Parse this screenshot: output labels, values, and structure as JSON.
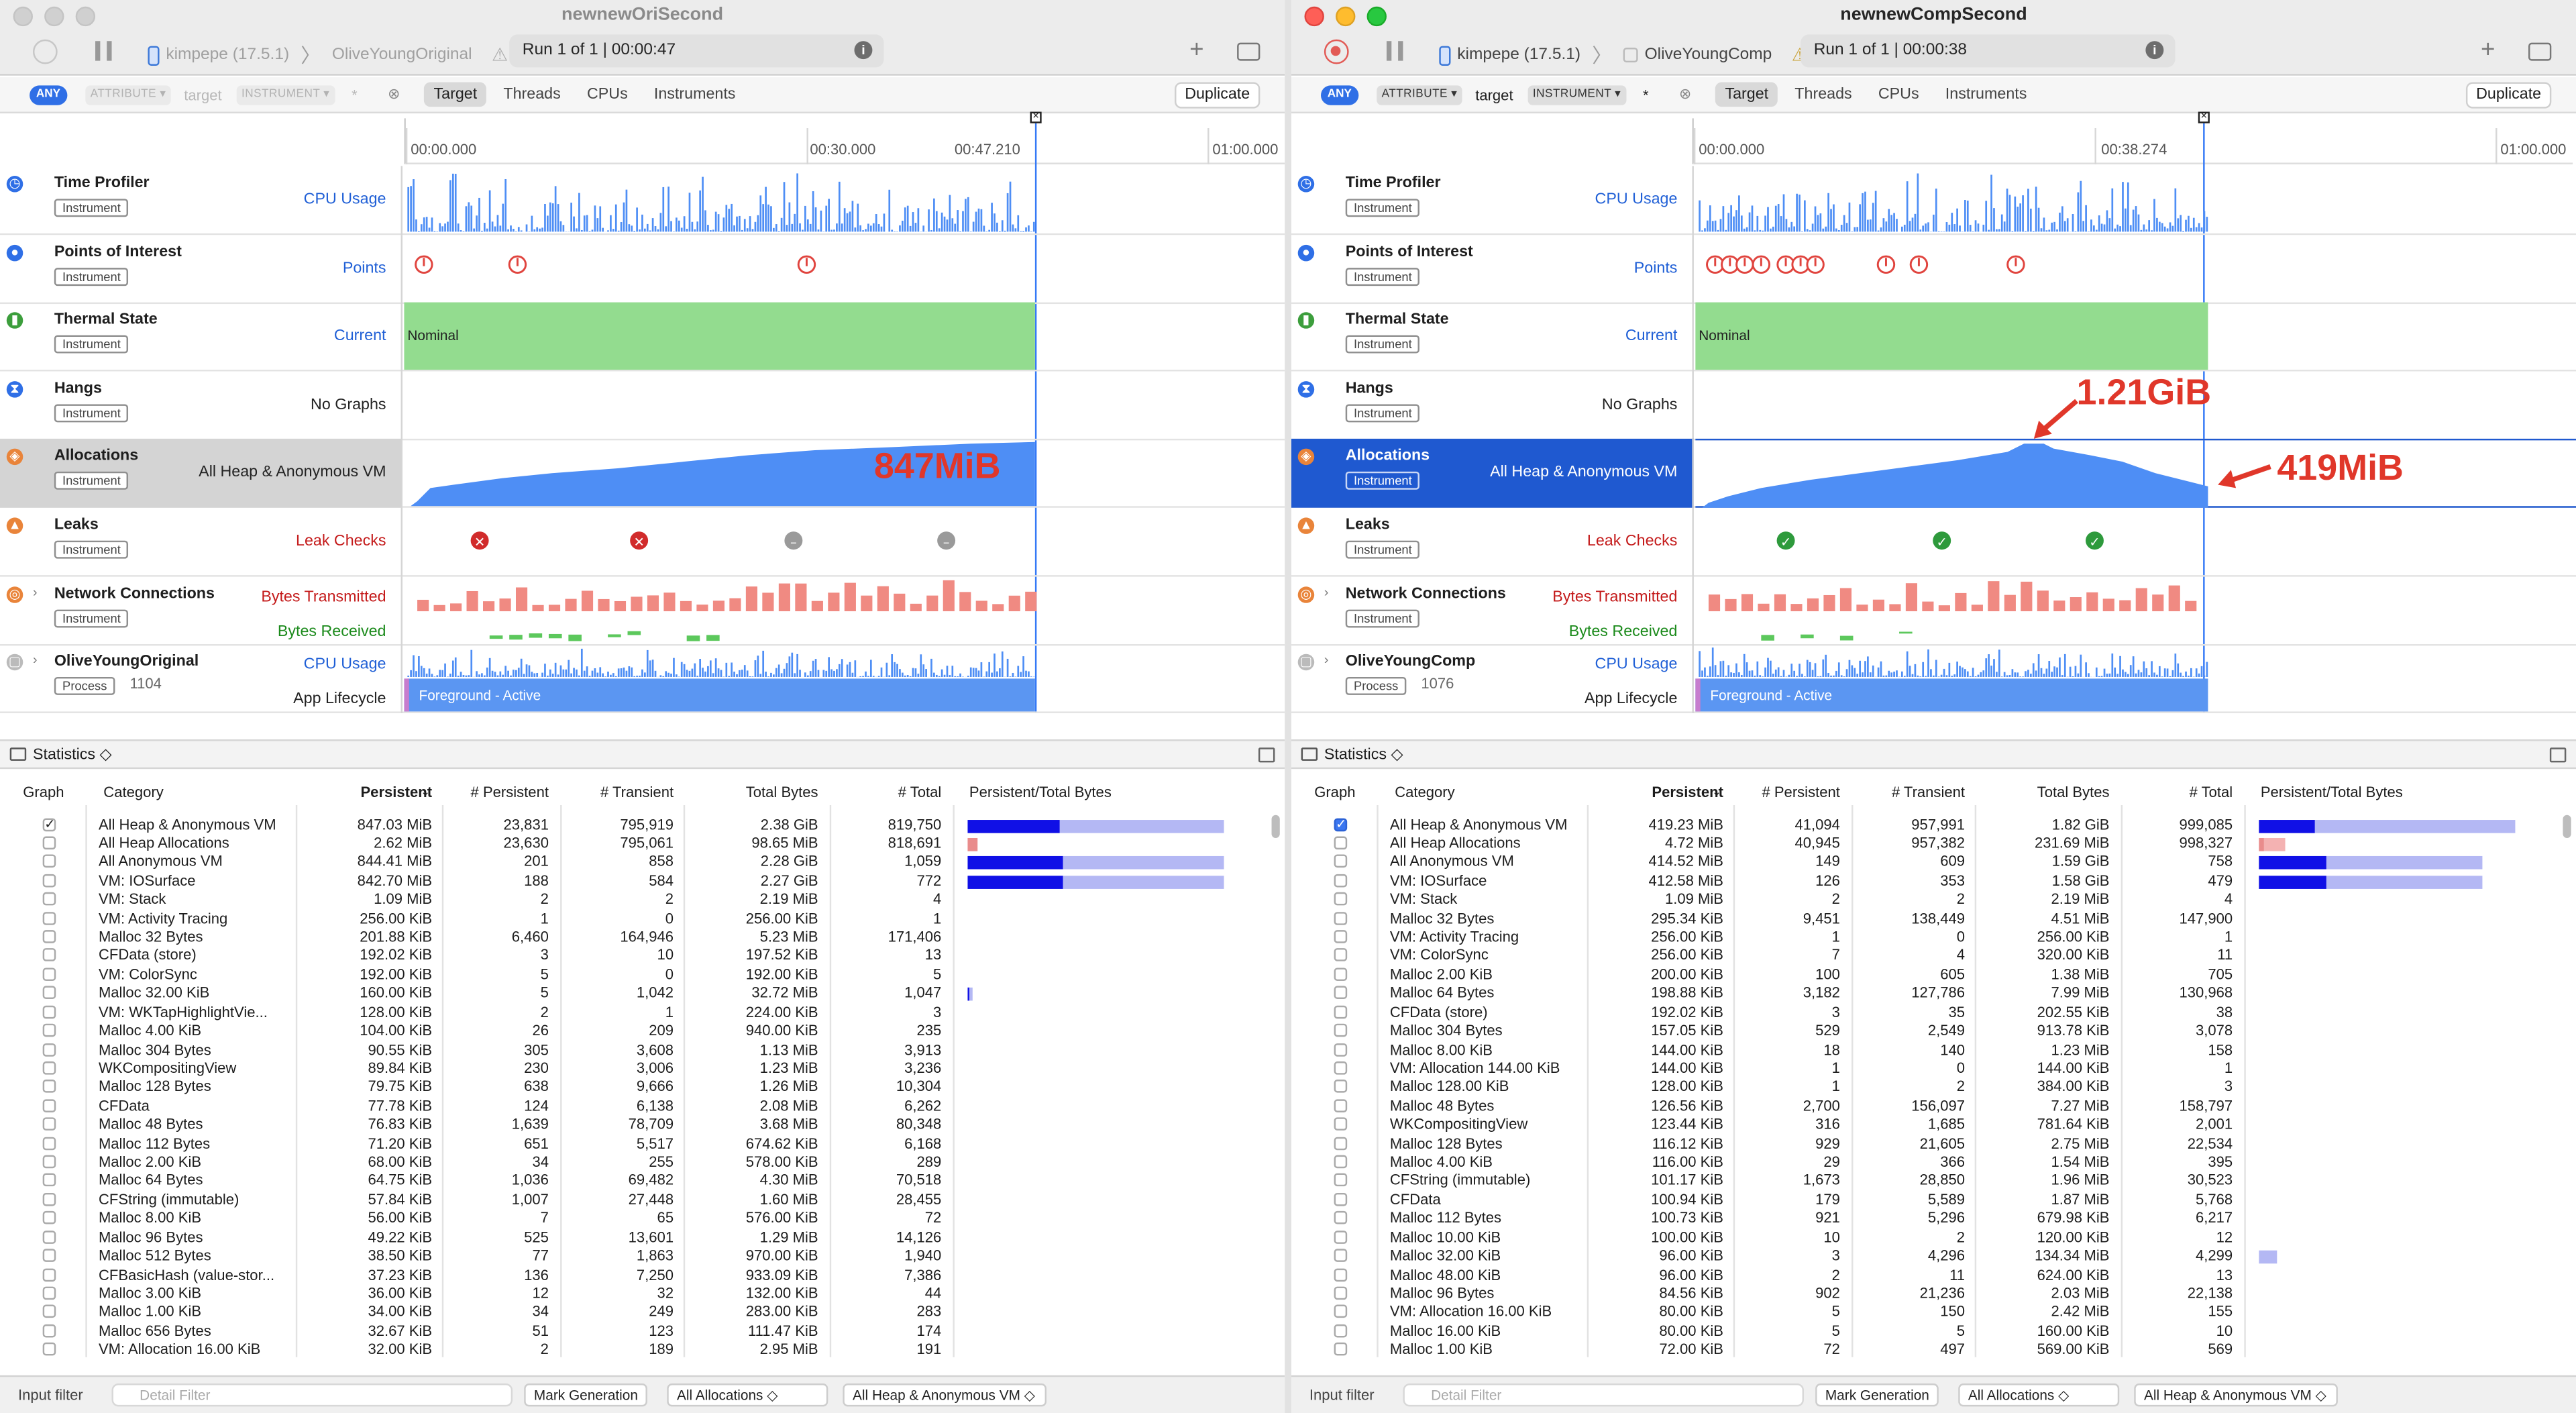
{
  "left": {
    "title": "newnewOriSecond",
    "device": "kimpepe (17.5.1)",
    "app": "OliveYoungOriginal",
    "run": "Run 1 of 1  |  00:00:47",
    "filter": {
      "any": "ANY",
      "attr": "ATTRIBUTE ▾",
      "target": "target",
      "inst": "INSTRUMENT ▾",
      "star": "*"
    },
    "tabs": [
      "Target",
      "Threads",
      "CPUs",
      "Instruments"
    ],
    "duplicate": "Duplicate",
    "ruler": {
      "t0": "00:00.000",
      "t1": "00:30.000",
      "t2": "00:47.210",
      "t3": "01:00.000"
    },
    "tracks": [
      {
        "name": "Time Profiler",
        "badge": "Instrument",
        "measure": "CPU Usage"
      },
      {
        "name": "Points of Interest",
        "badge": "Instrument",
        "measure": "Points"
      },
      {
        "name": "Thermal State",
        "badge": "Instrument",
        "measure": "Current",
        "state": "Nominal"
      },
      {
        "name": "Hangs",
        "badge": "Instrument",
        "measure": "No Graphs"
      },
      {
        "name": "Allocations",
        "badge": "Instrument",
        "measure": "All Heap & Anonymous VM"
      },
      {
        "name": "Leaks",
        "badge": "Instrument",
        "measure": "Leak Checks"
      },
      {
        "name": "Network Connections",
        "badge": "Instrument",
        "measure": "Bytes Transmitted",
        "measure2": "Bytes Received"
      },
      {
        "name": "OliveYoungOriginal",
        "badge": "Process",
        "pid": "1104",
        "measure": "CPU Usage",
        "measure2": "App Lifecycle",
        "lifecycle": "Foreground - Active"
      }
    ],
    "annotations": {
      "peak": "847MiB"
    },
    "statistics_label": "Statistics ◇",
    "headers": [
      "Graph",
      "Category",
      "Persistent",
      "# Persistent",
      "# Transient",
      "Total Bytes",
      "# Total",
      "Persistent/Total Bytes"
    ],
    "rows": [
      [
        "All Heap & Anonymous VM",
        "847.03 MiB",
        "23,831",
        "795,919",
        "2.38 GiB",
        "819,750"
      ],
      [
        "All Heap Allocations",
        "2.62 MiB",
        "23,630",
        "795,061",
        "98.65 MiB",
        "818,691"
      ],
      [
        "All Anonymous VM",
        "844.41 MiB",
        "201",
        "858",
        "2.28 GiB",
        "1,059"
      ],
      [
        "VM: IOSurface",
        "842.70 MiB",
        "188",
        "584",
        "2.27 GiB",
        "772"
      ],
      [
        "VM: Stack",
        "1.09 MiB",
        "2",
        "2",
        "2.19 MiB",
        "4"
      ],
      [
        "VM: Activity Tracing",
        "256.00 KiB",
        "1",
        "0",
        "256.00 KiB",
        "1"
      ],
      [
        "Malloc 32 Bytes",
        "201.88 KiB",
        "6,460",
        "164,946",
        "5.23 MiB",
        "171,406"
      ],
      [
        "CFData (store)",
        "192.02 KiB",
        "3",
        "10",
        "197.52 KiB",
        "13"
      ],
      [
        "VM: ColorSync",
        "192.00 KiB",
        "5",
        "0",
        "192.00 KiB",
        "5"
      ],
      [
        "Malloc 32.00 KiB",
        "160.00 KiB",
        "5",
        "1,042",
        "32.72 MiB",
        "1,047"
      ],
      [
        "VM: WKTapHighlightVie...",
        "128.00 KiB",
        "2",
        "1",
        "224.00 KiB",
        "3"
      ],
      [
        "Malloc 4.00 KiB",
        "104.00 KiB",
        "26",
        "209",
        "940.00 KiB",
        "235"
      ],
      [
        "Malloc 304 Bytes",
        "90.55 KiB",
        "305",
        "3,608",
        "1.13 MiB",
        "3,913"
      ],
      [
        "WKCompositingView",
        "89.84 KiB",
        "230",
        "3,006",
        "1.23 MiB",
        "3,236"
      ],
      [
        "Malloc 128 Bytes",
        "79.75 KiB",
        "638",
        "9,666",
        "1.26 MiB",
        "10,304"
      ],
      [
        "CFData",
        "77.78 KiB",
        "124",
        "6,138",
        "2.08 MiB",
        "6,262"
      ],
      [
        "Malloc 48 Bytes",
        "76.83 KiB",
        "1,639",
        "78,709",
        "3.68 MiB",
        "80,348"
      ],
      [
        "Malloc 112 Bytes",
        "71.20 KiB",
        "651",
        "5,517",
        "674.62 KiB",
        "6,168"
      ],
      [
        "Malloc 2.00 KiB",
        "68.00 KiB",
        "34",
        "255",
        "578.00 KiB",
        "289"
      ],
      [
        "Malloc 64 Bytes",
        "64.75 KiB",
        "1,036",
        "69,482",
        "4.30 MiB",
        "70,518"
      ],
      [
        "CFString (immutable)",
        "57.84 KiB",
        "1,007",
        "27,448",
        "1.60 MiB",
        "28,455"
      ],
      [
        "Malloc 8.00 KiB",
        "56.00 KiB",
        "7",
        "65",
        "576.00 KiB",
        "72"
      ],
      [
        "Malloc 96 Bytes",
        "49.22 KiB",
        "525",
        "13,601",
        "1.29 MiB",
        "14,126"
      ],
      [
        "Malloc 512 Bytes",
        "38.50 KiB",
        "77",
        "1,863",
        "970.00 KiB",
        "1,940"
      ],
      [
        "CFBasicHash (value-stor...",
        "37.23 KiB",
        "136",
        "7,250",
        "933.09 KiB",
        "7,386"
      ],
      [
        "Malloc 3.00 KiB",
        "36.00 KiB",
        "12",
        "32",
        "132.00 KiB",
        "44"
      ],
      [
        "Malloc 1.00 KiB",
        "34.00 KiB",
        "34",
        "249",
        "283.00 KiB",
        "283"
      ],
      [
        "Malloc 656 Bytes",
        "32.67 KiB",
        "51",
        "123",
        "111.47 KiB",
        "174"
      ],
      [
        "VM: Allocation 16.00 KiB",
        "32.00 KiB",
        "2",
        "189",
        "2.95 MiB",
        "191"
      ]
    ],
    "ratios": [
      [
        0.36,
        1.0
      ],
      [
        0.04,
        0.04
      ],
      [
        0.37,
        1.0
      ],
      [
        0.37,
        1.0
      ],
      null,
      null,
      null,
      null,
      null,
      [
        0.005,
        0.02
      ],
      null,
      null,
      null,
      null,
      null,
      null,
      null,
      null,
      null,
      null,
      null,
      null,
      null,
      null,
      null,
      null,
      null,
      null,
      null
    ],
    "input": {
      "label": "Input filter",
      "placeholder": "Detail Filter",
      "mark": "Mark Generation",
      "alloc": "All Allocations ◇",
      "heap": "All Heap & Anonymous VM ◇"
    }
  },
  "right": {
    "title": "newnewCompSecond",
    "device": "kimpepe (17.5.1)",
    "app": "OliveYoungComp",
    "run": "Run 1 of 1  |  00:00:38",
    "filter": {
      "any": "ANY",
      "attr": "ATTRIBUTE ▾",
      "target": "target",
      "inst": "INSTRUMENT ▾",
      "star": "*"
    },
    "tabs": [
      "Target",
      "Threads",
      "CPUs",
      "Instruments"
    ],
    "duplicate": "Duplicate",
    "ruler": {
      "t0": "00:00.000",
      "t1": "00:38.274",
      "t3": "01:00.000"
    },
    "tracks": [
      {
        "name": "Time Profiler",
        "badge": "Instrument",
        "measure": "CPU Usage"
      },
      {
        "name": "Points of Interest",
        "badge": "Instrument",
        "measure": "Points"
      },
      {
        "name": "Thermal State",
        "badge": "Instrument",
        "measure": "Current",
        "state": "Nominal"
      },
      {
        "name": "Hangs",
        "badge": "Instrument",
        "measure": "No Graphs"
      },
      {
        "name": "Allocations",
        "badge": "Instrument",
        "measure": "All Heap & Anonymous VM"
      },
      {
        "name": "Leaks",
        "badge": "Instrument",
        "measure": "Leak Checks"
      },
      {
        "name": "Network Connections",
        "badge": "Instrument",
        "measure": "Bytes Transmitted",
        "measure2": "Bytes Received"
      },
      {
        "name": "OliveYoungComp",
        "badge": "Process",
        "pid": "1076",
        "measure": "CPU Usage",
        "measure2": "App Lifecycle",
        "lifecycle": "Foreground - Active"
      }
    ],
    "annotations": {
      "peak": "1.21GiB",
      "end": "419MiB"
    },
    "statistics_label": "Statistics ◇",
    "headers": [
      "Graph",
      "Category",
      "Persistent",
      "# Persistent",
      "# Transient",
      "Total Bytes",
      "# Total",
      "Persistent/Total Bytes"
    ],
    "rows": [
      [
        "All Heap & Anonymous VM",
        "419.23 MiB",
        "41,094",
        "957,991",
        "1.82 GiB",
        "999,085"
      ],
      [
        "All Heap Allocations",
        "4.72 MiB",
        "40,945",
        "957,382",
        "231.69 MiB",
        "998,327"
      ],
      [
        "All Anonymous VM",
        "414.52 MiB",
        "149",
        "609",
        "1.59 GiB",
        "758"
      ],
      [
        "VM: IOSurface",
        "412.58 MiB",
        "126",
        "353",
        "1.58 GiB",
        "479"
      ],
      [
        "VM: Stack",
        "1.09 MiB",
        "2",
        "2",
        "2.19 MiB",
        "4"
      ],
      [
        "Malloc 32 Bytes",
        "295.34 KiB",
        "9,451",
        "138,449",
        "4.51 MiB",
        "147,900"
      ],
      [
        "VM: Activity Tracing",
        "256.00 KiB",
        "1",
        "0",
        "256.00 KiB",
        "1"
      ],
      [
        "VM: ColorSync",
        "256.00 KiB",
        "7",
        "4",
        "320.00 KiB",
        "11"
      ],
      [
        "Malloc 2.00 KiB",
        "200.00 KiB",
        "100",
        "605",
        "1.38 MiB",
        "705"
      ],
      [
        "Malloc 64 Bytes",
        "198.88 KiB",
        "3,182",
        "127,786",
        "7.99 MiB",
        "130,968"
      ],
      [
        "CFData (store)",
        "192.02 KiB",
        "3",
        "35",
        "202.55 KiB",
        "38"
      ],
      [
        "Malloc 304 Bytes",
        "157.05 KiB",
        "529",
        "2,549",
        "913.78 KiB",
        "3,078"
      ],
      [
        "Malloc 8.00 KiB",
        "144.00 KiB",
        "18",
        "140",
        "1.23 MiB",
        "158"
      ],
      [
        "VM: Allocation 144.00 KiB",
        "144.00 KiB",
        "1",
        "0",
        "144.00 KiB",
        "1"
      ],
      [
        "Malloc 128.00 KiB",
        "128.00 KiB",
        "1",
        "2",
        "384.00 KiB",
        "3"
      ],
      [
        "Malloc 48 Bytes",
        "126.56 KiB",
        "2,700",
        "156,097",
        "7.27 MiB",
        "158,797"
      ],
      [
        "WKCompositingView",
        "123.44 KiB",
        "316",
        "1,685",
        "781.64 KiB",
        "2,001"
      ],
      [
        "Malloc 128 Bytes",
        "116.12 KiB",
        "929",
        "21,605",
        "2.75 MiB",
        "22,534"
      ],
      [
        "Malloc 4.00 KiB",
        "116.00 KiB",
        "29",
        "366",
        "1.54 MiB",
        "395"
      ],
      [
        "CFString (immutable)",
        "101.17 KiB",
        "1,673",
        "28,850",
        "1.96 MiB",
        "30,523"
      ],
      [
        "CFData",
        "100.94 KiB",
        "179",
        "5,589",
        "1.87 MiB",
        "5,768"
      ],
      [
        "Malloc 112 Bytes",
        "100.73 KiB",
        "921",
        "5,296",
        "679.98 KiB",
        "6,217"
      ],
      [
        "Malloc 10.00 KiB",
        "100.00 KiB",
        "10",
        "2",
        "120.00 KiB",
        "12"
      ],
      [
        "Malloc 32.00 KiB",
        "96.00 KiB",
        "3",
        "4,296",
        "134.34 MiB",
        "4,299"
      ],
      [
        "Malloc 48.00 KiB",
        "96.00 KiB",
        "2",
        "11",
        "624.00 KiB",
        "13"
      ],
      [
        "Malloc 96 Bytes",
        "84.56 KiB",
        "902",
        "21,236",
        "2.03 MiB",
        "22,138"
      ],
      [
        "VM: Allocation 16.00 KiB",
        "80.00 KiB",
        "5",
        "150",
        "2.42 MiB",
        "155"
      ],
      [
        "Malloc 16.00 KiB",
        "80.00 KiB",
        "5",
        "5",
        "160.00 KiB",
        "10"
      ],
      [
        "Malloc 1.00 KiB",
        "72.00 KiB",
        "72",
        "497",
        "569.00 KiB",
        "569"
      ]
    ],
    "ratios": [
      [
        0.22,
        1.0
      ],
      [
        0.02,
        0.1
      ],
      [
        0.26,
        0.87
      ],
      [
        0.26,
        0.87
      ],
      null,
      null,
      null,
      null,
      null,
      null,
      null,
      null,
      null,
      null,
      null,
      null,
      null,
      null,
      null,
      null,
      null,
      null,
      null,
      [
        0.0,
        0.07
      ],
      null,
      null,
      null,
      null,
      null
    ],
    "input": {
      "label": "Input filter",
      "placeholder": "Detail Filter",
      "mark": "Mark Generation",
      "alloc": "All Allocations ◇",
      "heap": "All Heap & Anonymous VM ◇"
    }
  },
  "colors": {
    "accent": "#2f6fe6",
    "graphBlue": "#4e8ef5",
    "nominal": "#93dc8f",
    "annotation": "#e0372a",
    "barDark": "#1010e6",
    "barLight": "#b4b8f4"
  }
}
